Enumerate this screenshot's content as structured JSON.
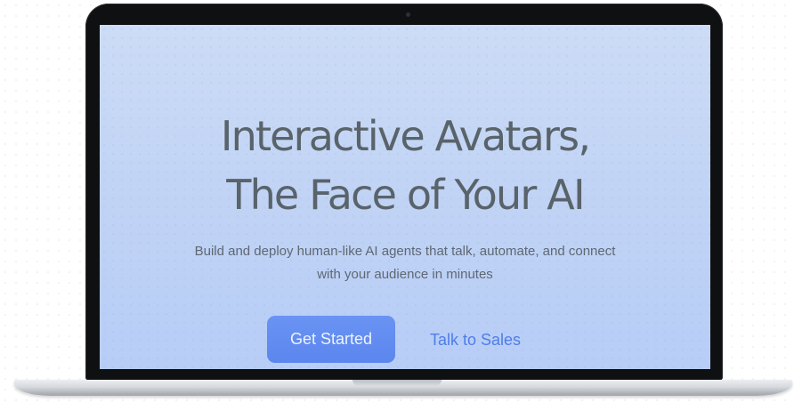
{
  "hero": {
    "title_line1": "Interactive Avatars,",
    "title_line2": "The Face of Your AI",
    "subtitle_line1": "Build and deploy human-like AI agents that talk, automate, and connect",
    "subtitle_line2": "with your audience in minutes"
  },
  "actions": {
    "primary_label": "Get Started",
    "secondary_label": "Talk to Sales"
  },
  "colors": {
    "screen_gradient_top": "#ccdcf6",
    "screen_gradient_bottom": "#b7cdf6",
    "title_text": "#59636a",
    "primary_button": "#5b86ee",
    "link": "#4f7de8"
  }
}
